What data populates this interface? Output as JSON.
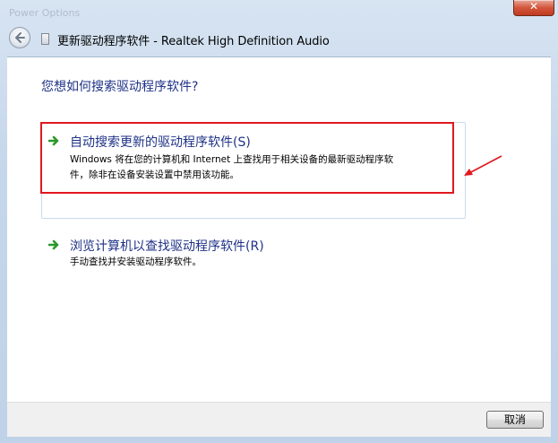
{
  "window": {
    "background_title": "Power Options",
    "close_label": "✕",
    "title": "更新驱动程序软件 - Realtek High Definition Audio"
  },
  "dialog": {
    "question": "您想如何搜索驱动程序软件?",
    "options": [
      {
        "title": "自动搜索更新的驱动程序软件(S)",
        "description_line1": "Windows 将在您的计算机和 Internet 上查找用于相关设备的最新驱动程序软",
        "description_line2": "件，除非在设备安装设置中禁用该功能。",
        "icon": "green-arrow-icon"
      },
      {
        "title": "浏览计算机以查找驱动程序软件(R)",
        "description_line1": "手动查找并安装驱动程序软件。",
        "icon": "green-arrow-icon"
      }
    ]
  },
  "footer": {
    "cancel_label": "取消"
  },
  "colors": {
    "link_blue": "#1e3287",
    "highlight_red": "#e0181e",
    "arrow_green": "#2a9a2a"
  }
}
